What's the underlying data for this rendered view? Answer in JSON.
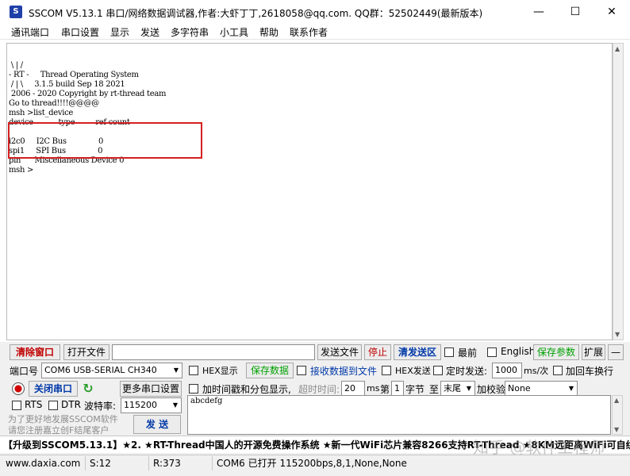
{
  "window": {
    "title": "SSCOM V5.13.1 串口/网络数据调试器,作者:大虾丁丁,2618058@qq.com. QQ群：52502449(最新版本)",
    "minimize_glyph": "—",
    "maximize_glyph": "☐",
    "close_glyph": "✕"
  },
  "menu": [
    "通讯端口",
    "串口设置",
    "显示",
    "发送",
    "多字符串",
    "小工具",
    "帮助",
    "联系作者"
  ],
  "console": {
    "lines": [
      " \\ | /",
      "- RT -     Thread Operating System",
      " / | \\     3.1.5 build Sep 18 2021",
      " 2006 - 2020 Copyright by rt-thread team",
      "Go to thread!!!!@@@@",
      "msh >list_device",
      "device           type         ref count",
      "",
      "i2c0     I2C Bus              0",
      "spi1     SPI Bus              0",
      "pin      Miscellaneous Device 0",
      "msh >"
    ]
  },
  "toolbar_row": {
    "clear_window": "清除窗口",
    "open_file": "打开文件",
    "file_path": "",
    "send_file": "发送文件",
    "stop": "停止",
    "clear_send": "清发送区",
    "last_label": "最前",
    "english_label": "English",
    "save_params": "保存参数",
    "expand": "扩展",
    "collapse": "—"
  },
  "port_row": {
    "port_label": "端口号",
    "port_value": "COM6 USB-SERIAL CH340",
    "hex_display": "HEX显示",
    "save_data": "保存数据",
    "recv_to_file": "接收数据到文件",
    "hex_send": "HEX发送",
    "timed_send": "定时发送:",
    "interval": "1000",
    "interval_unit": "ms/次",
    "add_newline": "加回车换行"
  },
  "control_row": {
    "close_port": "关闭串口",
    "more_settings": "更多串口设置",
    "timestamp": "加时间戳和分包显示,",
    "timeout_label": "超时时间:",
    "timeout_value": "20",
    "ms": "ms",
    "nth": "第",
    "byte_index": "1",
    "bytes_label": "字节",
    "to": "至",
    "tail": "末尾",
    "checksum": "加校验",
    "checksum_value": "None"
  },
  "baud_row": {
    "rts": "RTS",
    "dtr": "DTR",
    "baud_label": "波特率:",
    "baud_value": "115200"
  },
  "send_area": {
    "text": "abcdefg",
    "promo": "为了更好地发展SSCOM软件\n请您注册嘉立创F结尾客户",
    "send_button": "发 送"
  },
  "marquee": "【升级到SSCOM5.13.1】★2. ★RT-Thread中国人的开源免费操作系统 ★新一代WiFi芯片兼容8266支持RT-Thread ★8KM远距离WiFi可自组网",
  "watermark": "知乎 @软件工程师",
  "status": {
    "website": "www.daxia.com",
    "sent": "S:12",
    "received": "R:373",
    "port_status": "COM6 已打开  115200bps,8,1,None,None"
  }
}
